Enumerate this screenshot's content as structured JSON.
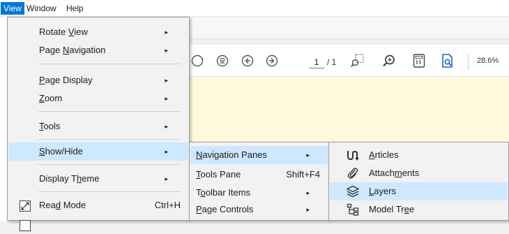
{
  "menubar": {
    "items": [
      {
        "label": "View"
      },
      {
        "label": "Window"
      },
      {
        "label": "Help"
      }
    ]
  },
  "toolbar": {
    "page_current": "1",
    "page_total": "/ 1",
    "zoom": "28.6%"
  },
  "view_menu": {
    "items": [
      {
        "pre": "Rotate ",
        "ul": "V",
        "post": "iew",
        "arrow": "▸"
      },
      {
        "pre": "Page ",
        "ul": "N",
        "post": "avigation",
        "arrow": "▸"
      },
      {
        "pre": "",
        "ul": "P",
        "post": "age Display",
        "arrow": "▸"
      },
      {
        "pre": "",
        "ul": "Z",
        "post": "oom",
        "arrow": "▸"
      },
      {
        "pre": "",
        "ul": "T",
        "post": "ools",
        "arrow": "▸"
      },
      {
        "pre": "",
        "ul": "S",
        "post": "how/Hide",
        "arrow": "▸"
      },
      {
        "pre": "Display T",
        "ul": "h",
        "post": "eme",
        "arrow": "▸"
      },
      {
        "pre": "Rea",
        "ul": "d",
        "post": " Mode",
        "shortcut": "Ctrl+H"
      }
    ]
  },
  "showhide_menu": {
    "items": [
      {
        "pre": "",
        "ul": "N",
        "post": "avigation Panes",
        "arrow": "▸"
      },
      {
        "pre": "",
        "ul": "T",
        "post": "ools Pane",
        "shortcut": "Shift+F4"
      },
      {
        "pre": "T",
        "ul": "o",
        "post": "olbar Items",
        "arrow": "▸"
      },
      {
        "pre": "",
        "ul": "P",
        "post": "age Controls",
        "arrow": "▸"
      }
    ]
  },
  "navpanes_menu": {
    "items": [
      {
        "pre": "",
        "ul": "A",
        "post": "rticles",
        "icon": "articles-icon"
      },
      {
        "pre": "Attach",
        "ul": "m",
        "post": "ents",
        "icon": "paperclip-icon"
      },
      {
        "pre": "",
        "ul": "L",
        "post": "ayers",
        "icon": "layers-icon"
      },
      {
        "pre": "Model Tr",
        "ul": "e",
        "post": "e",
        "icon": "model-tree-icon"
      }
    ]
  },
  "colors": {
    "menubar_active": "#0078d7",
    "menu_highlight": "#cde8ff",
    "document_background": "#fff8dd",
    "icon_blue": "#1a63c7"
  }
}
